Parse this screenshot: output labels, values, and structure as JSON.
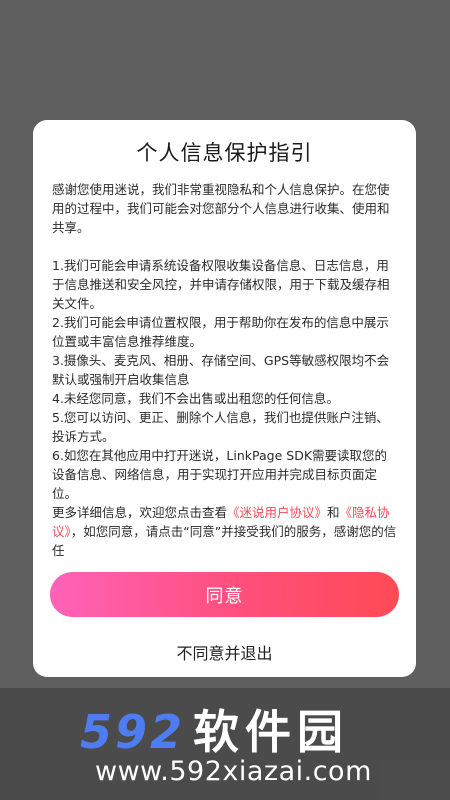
{
  "dialog": {
    "title": "个人信息保护指引",
    "intro": "感谢您使用迷说，我们非常重视隐私和个人信息保护。在您使用的过程中，我们可能会对您部分个人信息进行收集、使用和共享。",
    "items": [
      "1.我们可能会申请系统设备权限收集设备信息、日志信息，用于信息推送和安全风控，并申请存储权限，用于下载及缓存相关文件。",
      "2.我们可能会申请位置权限，用于帮助你在发布的信息中展示位置或丰富信息推荐维度。",
      "3.摄像头、麦克风、相册、存储空间、GPS等敏感权限均不会默认或强制开启收集信息",
      "4.未经您同意，我们不会出售或出租您的任何信息。",
      "5.您可以访问、更正、删除个人信息，我们也提供账户注销、投诉方式。",
      "6.如您在其他应用中打开迷说，LinkPage SDK需要读取您的设备信息、网络信息，用于实现打开应用并完成目标页面定位。"
    ],
    "more": {
      "prefix": "更多详细信息，欢迎您点击查看",
      "user_agreement_link": "《迷说用户协议》",
      "and": "和",
      "privacy_link": "《隐私协议》",
      "suffix": "，如您同意，请点击“同意”并接受我们的服务，感谢您的信任"
    },
    "agree_label": "同意",
    "decline_label": "不同意并退出",
    "colors": {
      "link": "#f04a5a",
      "button_gradient_start": "#ff62b8",
      "button_gradient_end": "#ff4a55",
      "overlay": "#5f5f5f"
    }
  },
  "watermark": {
    "logo_number": "592",
    "logo_text": "软件园",
    "url": "www.592xiazai.com"
  }
}
